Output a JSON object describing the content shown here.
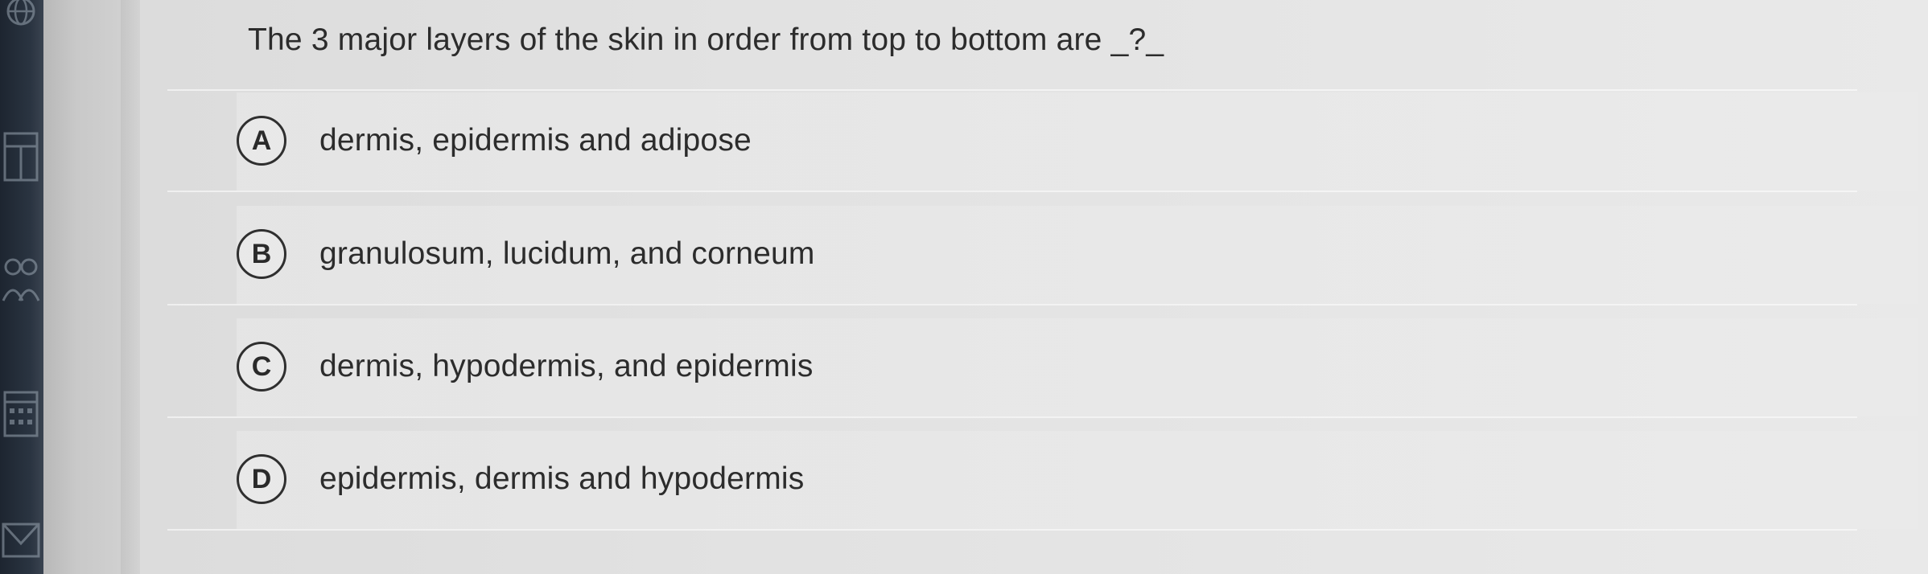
{
  "question": {
    "text": "The 3 major layers of the skin in order from top to bottom are _?_"
  },
  "options": [
    {
      "letter": "A",
      "text": "dermis, epidermis and adipose"
    },
    {
      "letter": "B",
      "text": "granulosum, lucidum, and corneum"
    },
    {
      "letter": "C",
      "text": "dermis, hypodermis, and epidermis"
    },
    {
      "letter": "D",
      "text": "epidermis, dermis and hypodermis"
    }
  ],
  "sidebar": {
    "icons": [
      "globe-icon",
      "book-icon",
      "people-icon",
      "calendar-icon",
      "mail-icon"
    ]
  },
  "colors": {
    "sidebar": "#1d2530",
    "text": "#2c2c2c",
    "page_background": "#e4e4e4"
  }
}
